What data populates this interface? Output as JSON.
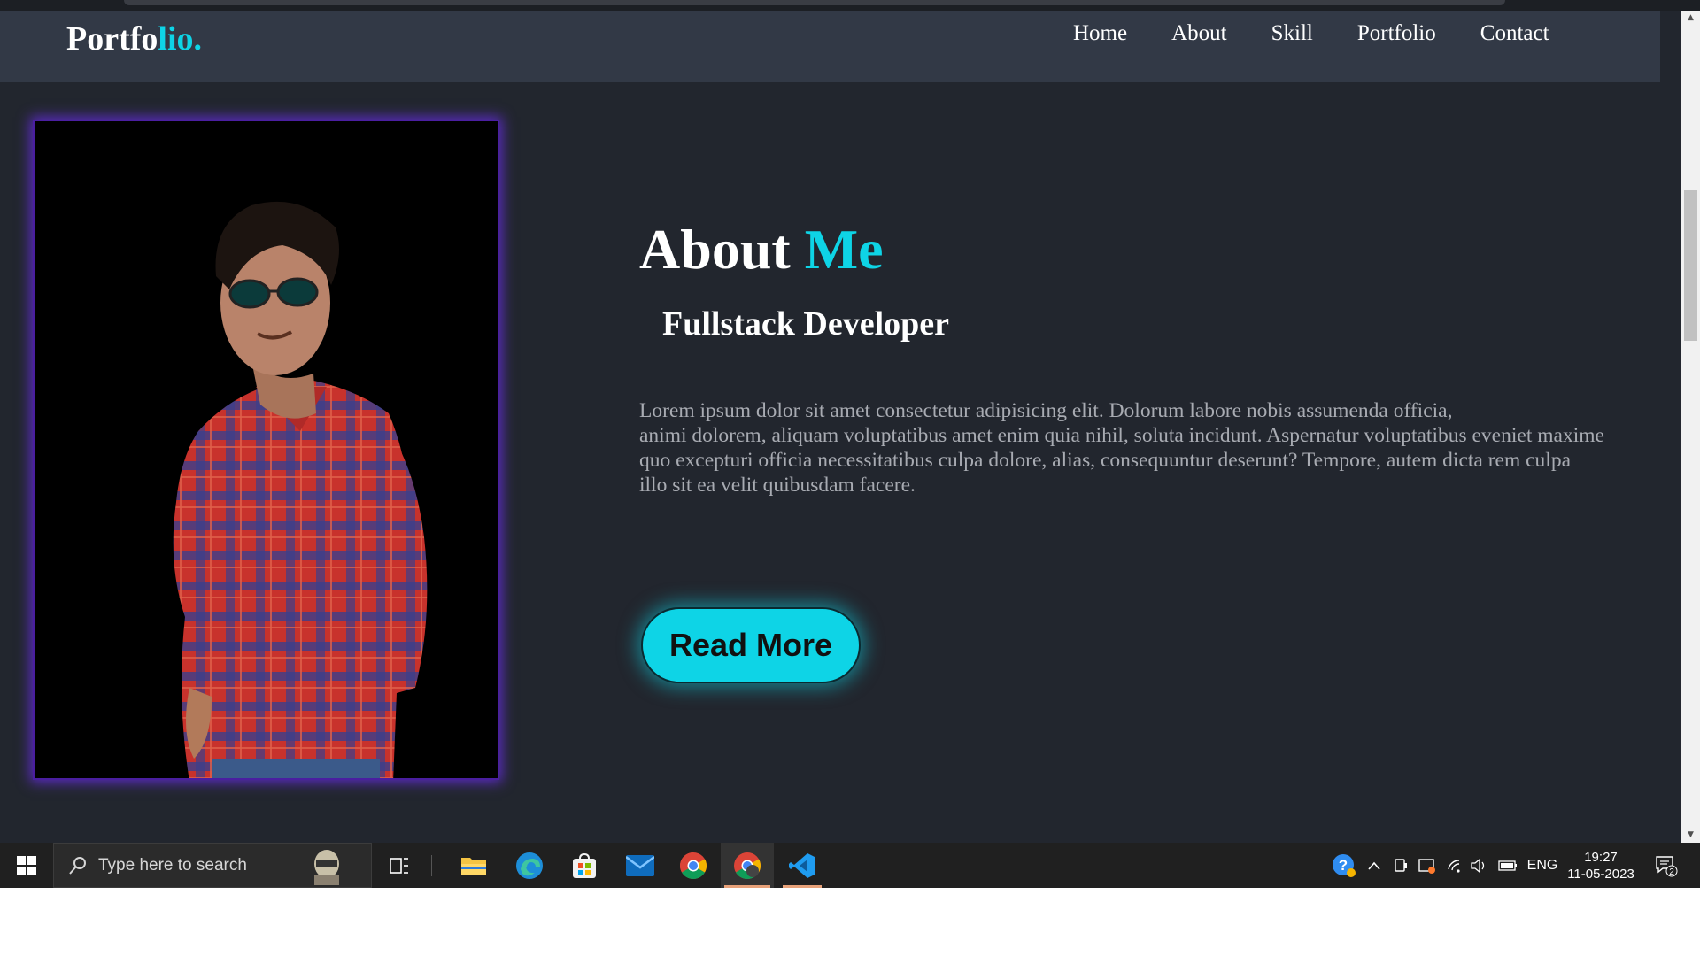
{
  "navbar": {
    "logo_main": "Portfo",
    "logo_accent": "lio.",
    "links": [
      "Home",
      "About",
      "Skill",
      "Portfolio",
      "Contact"
    ]
  },
  "about": {
    "heading_main": "About",
    "heading_accent": "Me",
    "role": "Fullstack Developer",
    "bio_lines": [
      "Lorem ipsum dolor sit amet consectetur adipisicing elit. Dolorum labore nobis assumenda officia,",
      "animi dolorem, aliquam voluptatibus amet enim quia nihil, soluta incidunt. Aspernatur voluptatibus eveniet maxime",
      "quo excepturi officia necessitatibus culpa dolore, alias, consequuntur deserunt? Tempore, autem dicta rem culpa",
      "illo sit ea velit quibusdam facere."
    ],
    "read_more_label": "Read More"
  },
  "taskbar": {
    "search_placeholder": "Type here to search",
    "language": "ENG",
    "time": "19:27",
    "date": "11-05-2023",
    "notification_count": "2",
    "pinned_apps": [
      "file-explorer-icon",
      "edge-icon",
      "microsoft-store-icon",
      "mail-icon",
      "chrome-icon",
      "chrome-icon",
      "vscode-icon"
    ]
  },
  "colors": {
    "accent": "#0ed4e6",
    "page_bg": "#22262e",
    "navbar_bg": "#323946",
    "photo_glow": "#5b2cc4"
  }
}
